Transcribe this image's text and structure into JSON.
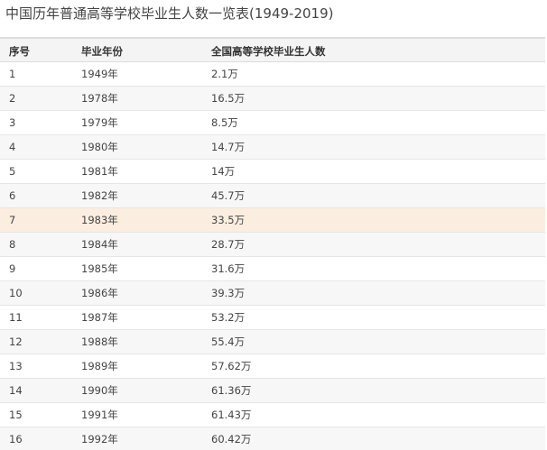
{
  "page": {
    "title": "中国历年普通高等学校毕业生人数一览表(1949-2019)"
  },
  "table": {
    "headers": [
      "序号",
      "毕业年份",
      "全国高等学校毕业生人数"
    ],
    "rows": [
      {
        "index": "1",
        "year": "1949年",
        "graduates": "2.1万"
      },
      {
        "index": "2",
        "year": "1978年",
        "graduates": "16.5万"
      },
      {
        "index": "3",
        "year": "1979年",
        "graduates": "8.5万"
      },
      {
        "index": "4",
        "year": "1980年",
        "graduates": "14.7万"
      },
      {
        "index": "5",
        "year": "1981年",
        "graduates": "14万"
      },
      {
        "index": "6",
        "year": "1982年",
        "graduates": "45.7万"
      },
      {
        "index": "7",
        "year": "1983年",
        "graduates": "33.5万"
      },
      {
        "index": "8",
        "year": "1984年",
        "graduates": "28.7万"
      },
      {
        "index": "9",
        "year": "1985年",
        "graduates": "31.6万"
      },
      {
        "index": "10",
        "year": "1986年",
        "graduates": "39.3万"
      },
      {
        "index": "11",
        "year": "1987年",
        "graduates": "53.2万"
      },
      {
        "index": "12",
        "year": "1988年",
        "graduates": "55.4万"
      },
      {
        "index": "13",
        "year": "1989年",
        "graduates": "57.62万"
      },
      {
        "index": "14",
        "year": "1990年",
        "graduates": "61.36万"
      },
      {
        "index": "15",
        "year": "1991年",
        "graduates": "61.43万"
      },
      {
        "index": "16",
        "year": "1992年",
        "graduates": "60.42万"
      }
    ],
    "highlighted_row_index": "7"
  },
  "colors": {
    "header_background": "#f4f4f4",
    "highlight_background": "#fbeee0",
    "row_border": "#e6e6e6"
  }
}
